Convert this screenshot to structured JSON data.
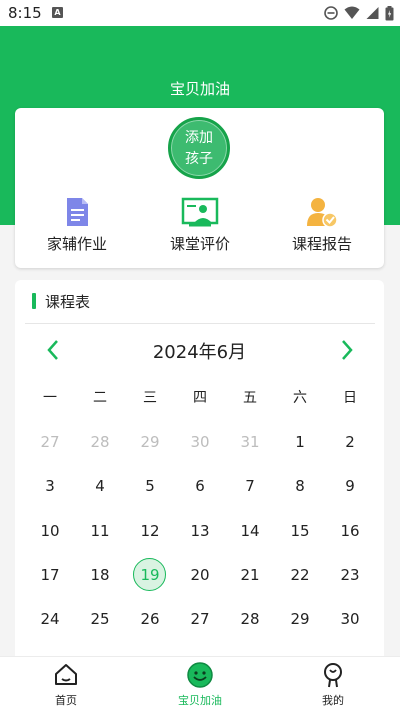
{
  "status_bar": {
    "time": "8:15",
    "notification_letter": "A"
  },
  "header": {
    "title": "宝贝加油"
  },
  "add_child": {
    "line1": "添加",
    "line2": "孩子"
  },
  "quick_actions": [
    {
      "label": "家辅作业",
      "icon": "document-icon"
    },
    {
      "label": "课堂评价",
      "icon": "classroom-icon"
    },
    {
      "label": "课程报告",
      "icon": "report-user-icon"
    }
  ],
  "schedule": {
    "title": "课程表",
    "month_label": "2024年6月",
    "weekdays": [
      "一",
      "二",
      "三",
      "四",
      "五",
      "六",
      "日"
    ],
    "weeks": [
      [
        "27",
        "28",
        "29",
        "30",
        "31",
        "1",
        "2"
      ],
      [
        "3",
        "4",
        "5",
        "6",
        "7",
        "8",
        "9"
      ],
      [
        "10",
        "11",
        "12",
        "13",
        "14",
        "15",
        "16"
      ],
      [
        "17",
        "18",
        "19",
        "20",
        "21",
        "22",
        "23"
      ],
      [
        "24",
        "25",
        "26",
        "27",
        "28",
        "29",
        "30"
      ]
    ],
    "muted_days": [
      "27",
      "28",
      "29",
      "30",
      "31"
    ],
    "today": "19"
  },
  "tabs": [
    {
      "label": "首页",
      "icon": "home-icon",
      "active": false
    },
    {
      "label": "宝贝加油",
      "icon": "smiley-icon",
      "active": true
    },
    {
      "label": "我的",
      "icon": "user-profile-icon",
      "active": false
    }
  ],
  "colors": {
    "brand_green": "#19b95b",
    "muted_day": "#bdbdbd",
    "today_fill": "#d9f3e2"
  }
}
